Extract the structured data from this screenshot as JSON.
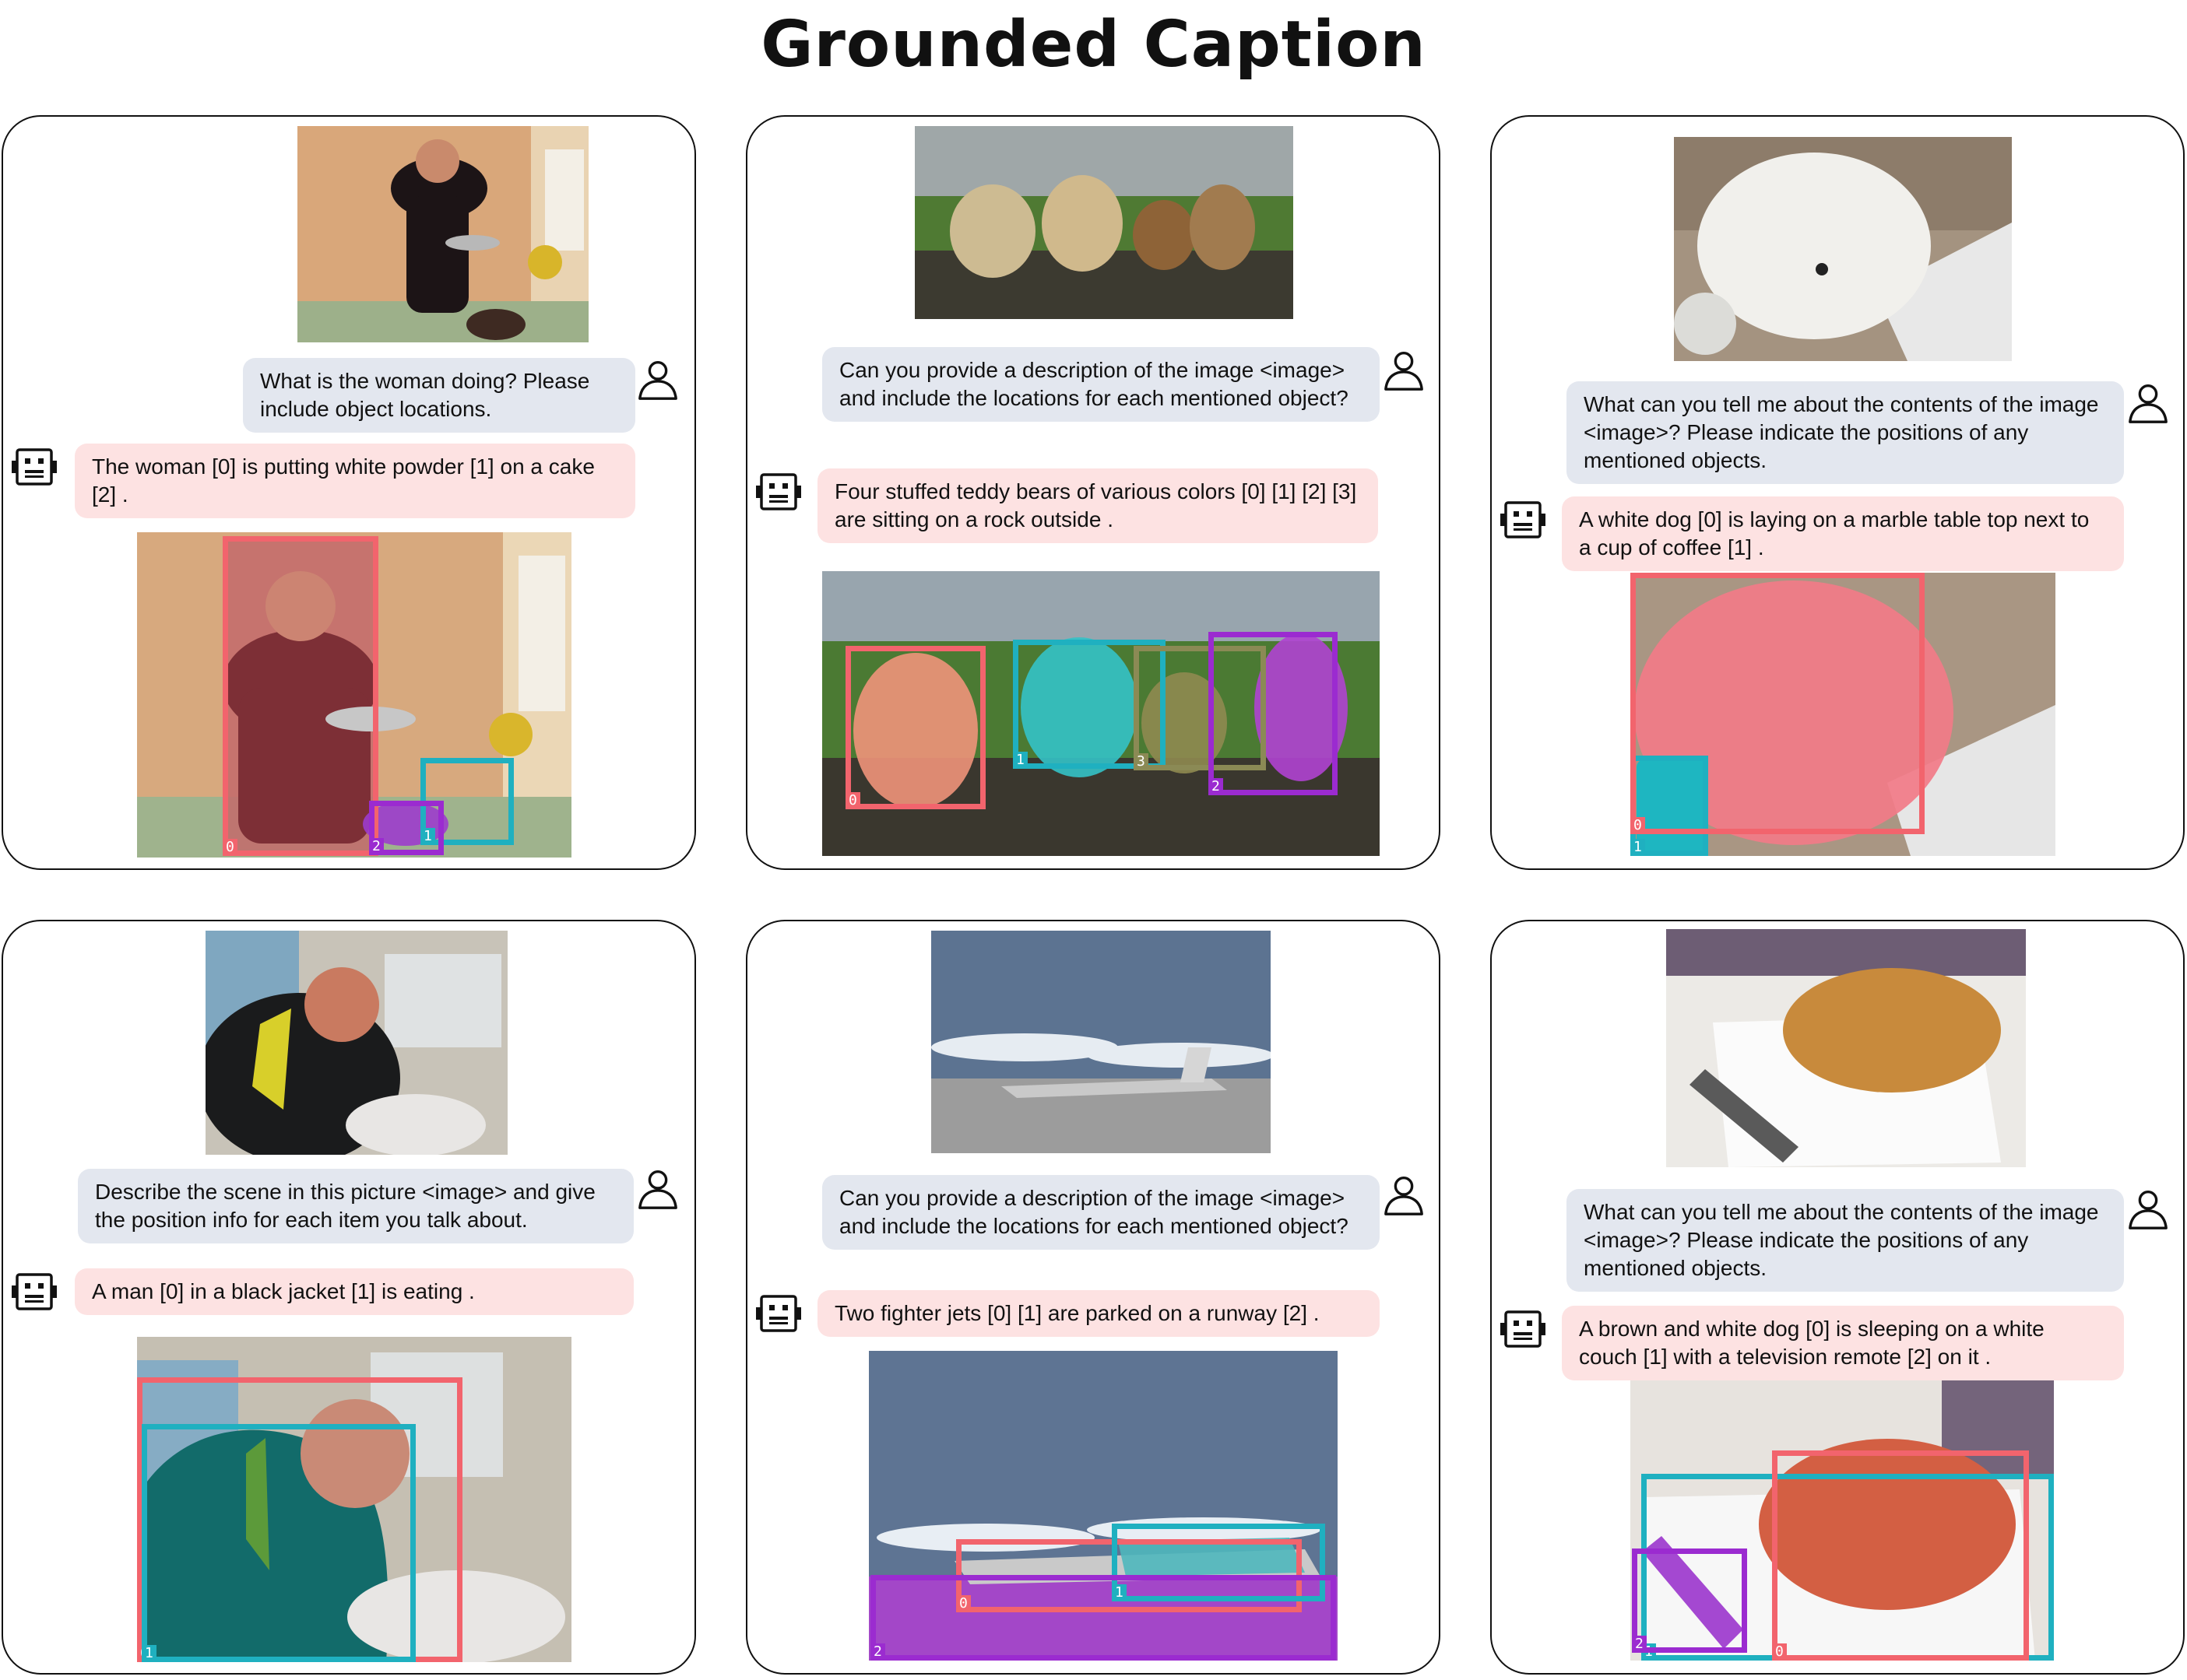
{
  "title": "Grounded Caption",
  "colors": {
    "red": "#f2646d",
    "teal": "#1fb0c0",
    "purple": "#9b2bd0",
    "olive": "#8b8a55"
  },
  "icons": {
    "user": "user-icon",
    "assistant": "robot-icon"
  },
  "panels": [
    {
      "question": "What is the woman doing? Please include object locations.",
      "answer": "The woman [0] is putting white powder [1] on a cake [2] .",
      "boxes": [
        {
          "label": "0",
          "color": "red"
        },
        {
          "label": "1",
          "color": "teal"
        },
        {
          "label": "2",
          "color": "purple"
        }
      ]
    },
    {
      "question": "Can you provide a description of the image <image> and include the locations for each mentioned object?",
      "answer": "Four stuffed teddy bears of various colors [0] [1] [2] [3] are sitting on a rock outside .",
      "boxes": [
        {
          "label": "0",
          "color": "red"
        },
        {
          "label": "1",
          "color": "teal"
        },
        {
          "label": "3",
          "color": "olive"
        },
        {
          "label": "2",
          "color": "purple"
        }
      ]
    },
    {
      "question": "What can you tell me about the contents of the image <image>? Please indicate the positions of any mentioned objects.",
      "answer": "A white dog [0] is laying on a marble table top next to a cup of coffee [1] .",
      "boxes": [
        {
          "label": "1",
          "color": "teal"
        },
        {
          "label": "0",
          "color": "red"
        }
      ]
    },
    {
      "question": "Describe the scene in this picture <image> and give the position info for each item you talk about.",
      "answer": "A man [0] in a black jacket [1] is eating .",
      "boxes": [
        {
          "label": "0",
          "color": "red"
        },
        {
          "label": "1",
          "color": "teal"
        }
      ]
    },
    {
      "question": "Can you provide a description of the image <image> and include the locations for each mentioned object?",
      "answer": "Two fighter jets [0] [1] are parked on a runway [2] .",
      "boxes": [
        {
          "label": "0",
          "color": "red"
        },
        {
          "label": "1",
          "color": "teal"
        },
        {
          "label": "2",
          "color": "purple"
        }
      ]
    },
    {
      "question": "What can you tell me about the contents of the image <image>? Please indicate the positions of any mentioned objects.",
      "answer": "A brown and white dog [0] is sleeping on a white couch [1] with a television remote [2] on it .",
      "boxes": [
        {
          "label": "1",
          "color": "teal"
        },
        {
          "label": "0",
          "color": "red"
        },
        {
          "label": "2",
          "color": "purple"
        }
      ]
    }
  ]
}
